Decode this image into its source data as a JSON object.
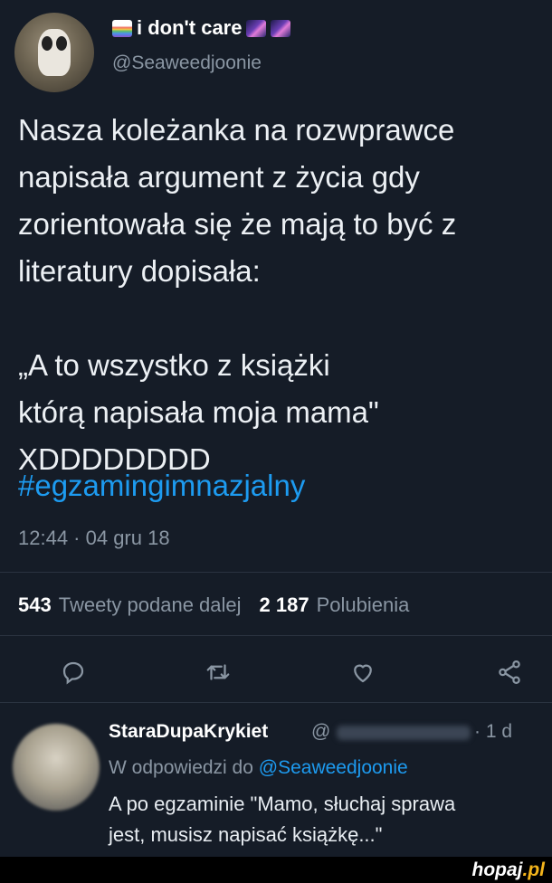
{
  "tweet": {
    "display_name": "i don't care",
    "handle": "@Seaweedjoonie",
    "text": "Nasza koleżanka na rozwprawce\nnapisała argument z życia gdy\nzorientowała się że mają to być z\nliteratury dopisała:\n\n„A to wszystko z książki\nktórą napisała moja mama\"\nXDDDDDDDD",
    "hashtag": "#egzamingimnazjalny",
    "timestamp": "12:44 · 04 gru 18",
    "retweets_count": "543",
    "retweets_label": "Tweety podane dalej",
    "likes_count": "2 187",
    "likes_label": "Polubienia"
  },
  "actions": {
    "icons": [
      "reply-icon",
      "retweet-icon",
      "like-icon",
      "share-icon"
    ]
  },
  "reply": {
    "name": "StaraDupaKrykiet",
    "handle_prefix": "@",
    "age": "· 1 d",
    "reply_to_prefix": "W odpowiedzi do",
    "reply_to_mention": "@Seaweedjoonie",
    "text": "A po egzaminie \"Mamo, słuchaj sprawa\njest, musisz napisać książkę...\""
  },
  "watermark": {
    "main": "hopaj",
    "suffix": ".pl"
  },
  "colors": {
    "background": "#151c27",
    "link": "#1d9bf0",
    "muted": "#8a96a3"
  }
}
